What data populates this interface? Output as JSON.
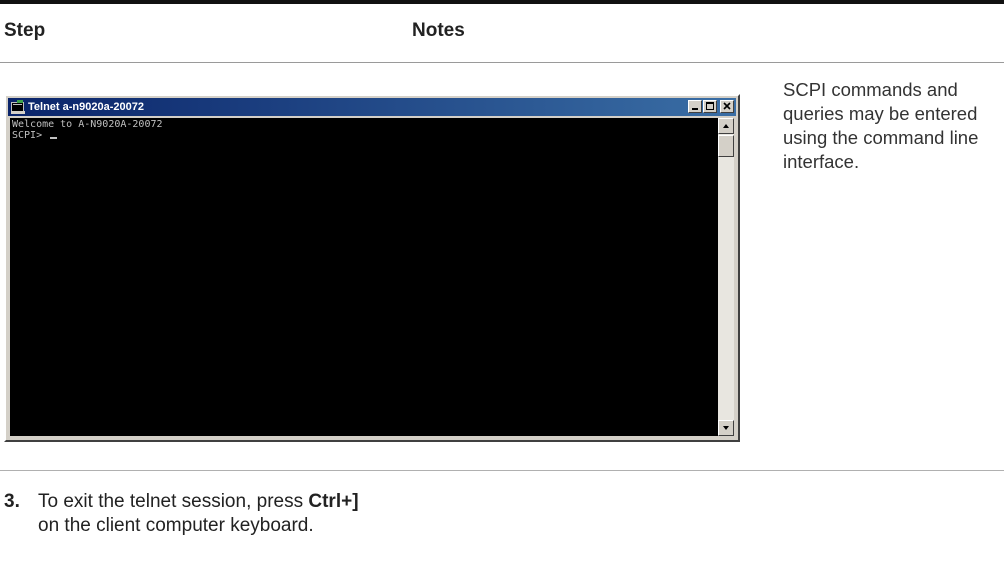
{
  "header": {
    "col_step": "Step",
    "col_notes": "Notes"
  },
  "telnet": {
    "title": "Telnet a-n9020a-20072",
    "console_lines": [
      "Welcome to A-N9020A-20072",
      "SCPI> "
    ],
    "minimize_icon": "minimize-icon",
    "maximize_icon": "maximize-icon",
    "close_icon": "close-icon"
  },
  "notes": {
    "text": "SCPI commands and queries may be entered using the command line interface."
  },
  "step3": {
    "number": "3.",
    "text_before": "To exit the telnet session, press ",
    "key": "Ctrl+]",
    "text_after": " on the client computer keyboard."
  },
  "colors": {
    "titlebar_start": "#0a246a",
    "titlebar_end": "#3a6ea5",
    "console_bg": "#000000",
    "console_text": "#c0c0c0"
  }
}
